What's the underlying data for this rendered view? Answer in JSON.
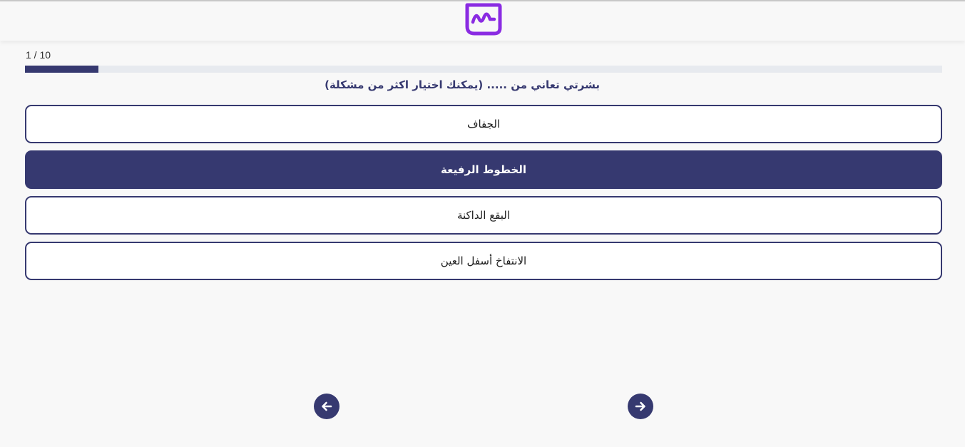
{
  "header": {
    "logo_color": "#8a2be2"
  },
  "progress": {
    "label": "1 / 10",
    "current": 1,
    "total": 10,
    "fill_fraction": 0.08
  },
  "question": {
    "text": "بشرتي تعاني من ..... (يمكنك اختيار اكثر من مشكلة)"
  },
  "options": [
    {
      "label": "الجفاف",
      "selected": false
    },
    {
      "label": "الخطوط الرفيعة",
      "selected": true
    },
    {
      "label": "البقع الداكنة",
      "selected": false
    },
    {
      "label": "الانتفاخ أسفل العين",
      "selected": false
    }
  ],
  "navigation": {
    "prev_icon": "arrow-left-icon",
    "next_icon": "arrow-right-icon"
  },
  "colors": {
    "primary": "#363970",
    "accent": "#8a2be2",
    "track": "#e7eaef"
  }
}
